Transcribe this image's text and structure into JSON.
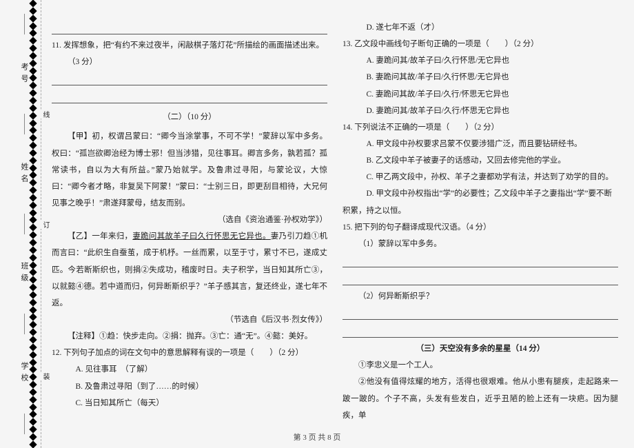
{
  "binding_margin": {
    "labels": [
      "学校",
      "班级",
      "姓名",
      "考号"
    ],
    "markers": [
      "装",
      "订",
      "线"
    ]
  },
  "left_col": {
    "blank_line": " ",
    "q11": "11. 发挥想象，把“有约不来过夜半，闲敲棋子落灯花”所描绘的画面描述出来。",
    "q11_score": "（3 分）",
    "section2_title": "（二）（10 分）",
    "passage_jia_label": "【甲】",
    "passage_jia_text_1": "初，权谓吕蒙曰：“卿今当涂掌事，不可不学！”蒙辞以军中多务。权曰：“孤岂欲卿治经为博士邪！但当涉猎，见往事耳。卿言多务，孰若孤？孤常读书，自以为大有所益。”蒙乃始就学。及鲁肃过寻阳，与蒙论议，大惊曰：“卿今者才略，非复吴下阿蒙！”蒙曰：“士别三日，即更刮目相待，大兄何见事之晚乎！”肃遂拜蒙母，结友而别。",
    "passage_jia_source": "（选自《资治通鉴·孙权劝学》）",
    "passage_yi_label": "【乙】",
    "passage_yi_text_1": "一年来归，",
    "passage_yi_underlined": "妻跪问其故羊子曰久行怀思无它异也。",
    "passage_yi_text_2": "妻乃引刀趋①机而言曰：“此织生自蚕茧，成于机杼。一丝而累，以至于寸，累寸不已，遂成丈匹。今若断斯织也，则捐②失成功，稽废时日。夫子积学，当日知其所亡③，以就懿④德。若中道而归，何异断斯织乎？”羊子感其言，复还终业，遂七年不返。",
    "passage_yi_source": "（节选自《后汉书·烈女传》）",
    "notes_label": "【注释】",
    "notes_text": "①趋：快步走向。②捐：抛弃。③亡：通“无”。④懿：美好。",
    "q12": "12. 下列句子加点的词在文句中的意思解释有误的一项是（　　）（2 分）",
    "q12_a": "A. 见往事耳　（了解）",
    "q12_b": "B. 及鲁肃过寻阳（到了……的时候）",
    "q12_c": "C. 当日知其所亡（每天）"
  },
  "right_col": {
    "q12_d": "D. 遂七年不返（才）",
    "q13": "13. 乙文段中画线句子断句正确的一项是（　　）（2 分）",
    "q13_a": "A. 妻跪问其/故羊子曰/久行怀思/无它异也",
    "q13_b": "B. 妻跪问其故/羊子曰/久行怀思/无它异也",
    "q13_c": "C. 妻跪问其故/羊子曰/久行/怀思无它异也",
    "q13_d": "D. 妻跪问其/故羊子曰/久行/怀思无它异也",
    "q14": "14. 下列说法不正确的一项是（　　）（2 分）",
    "q14_a": "A. 甲文段中孙权要求吕蒙不仅要涉猎广泛，而且要钻研经书。",
    "q14_b": "B. 乙文段中羊子被妻子的话感动，又回去修完他的学业。",
    "q14_c": "C. 甲乙两文段中，孙权、羊子之妻都劝学有法，并达到了劝学的目的。",
    "q14_d": "D. 甲文段中孙权指出“学”的必要性；乙文段中羊子之妻指出“学”要不断积累，持之以恒。",
    "q15": "15. 把下列的句子翻译成现代汉语。（4 分）",
    "q15_1": "（1）蒙辞以军中多务。",
    "q15_2": "（2）何异断斯织乎？",
    "section3_title": "（三）天空没有多余的星星（14 分）",
    "para1": "①李忠义是一个工人。",
    "para2": "②他没有值得炫耀的地方，活得也很艰难。他从小患有腿疾，走起路来一跛一跛的。个子不高，头发有些发白，近乎丑陋的脸上还有一块疤。因为腿疾，单"
  },
  "footer": "第 3 页 共 8 页"
}
